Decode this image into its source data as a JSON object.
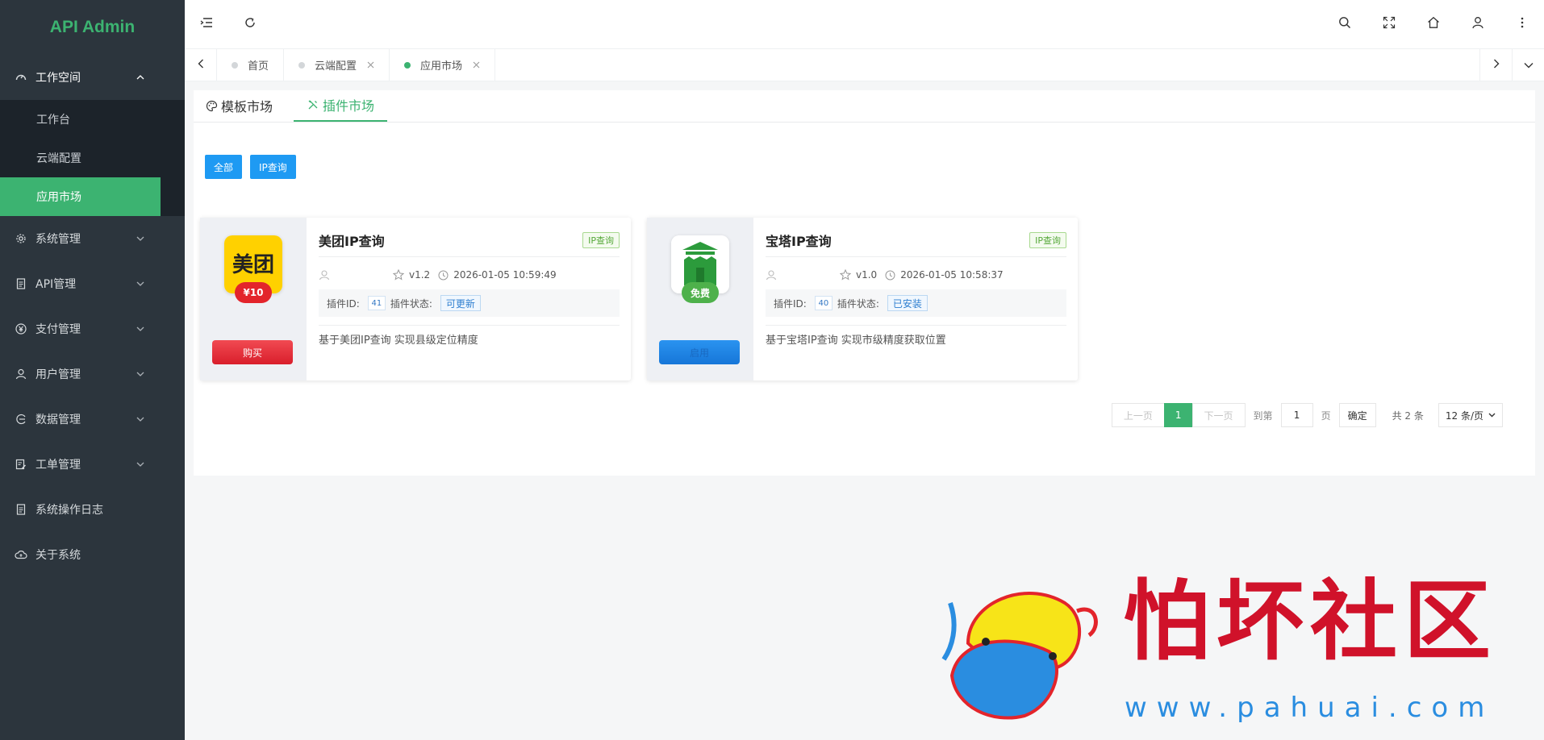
{
  "app": {
    "title": "API Admin",
    "accent": "#3cb371"
  },
  "sidebar": {
    "groups": [
      {
        "label": "工作空间",
        "icon": "dashboard-icon",
        "open": true,
        "children": [
          {
            "label": "工作台"
          },
          {
            "label": "云端配置"
          },
          {
            "label": "应用市场",
            "active": true
          }
        ]
      },
      {
        "label": "系统管理",
        "icon": "gear-icon"
      },
      {
        "label": "API管理",
        "icon": "document-icon"
      },
      {
        "label": "支付管理",
        "icon": "yen-icon"
      },
      {
        "label": "用户管理",
        "icon": "user-icon"
      },
      {
        "label": "数据管理",
        "icon": "data-icon"
      },
      {
        "label": "工单管理",
        "icon": "ticket-icon"
      },
      {
        "label": "系统操作日志",
        "icon": "log-icon"
      },
      {
        "label": "关于系统",
        "icon": "cloud-icon"
      }
    ]
  },
  "tabs": [
    {
      "label": "首页"
    },
    {
      "label": "云端配置"
    },
    {
      "label": "应用市场",
      "active": true
    }
  ],
  "sub_tabs": [
    {
      "label": "模板市场"
    },
    {
      "label": "插件市场",
      "active": true
    }
  ],
  "filters": [
    "全部",
    "IP查询"
  ],
  "cards": [
    {
      "title": "美团IP查询",
      "tag": "IP查询",
      "version": "v1.2",
      "time": "2026-01-05 10:59:49",
      "id_label": "插件ID:",
      "id": "41",
      "status_label": "插件状态:",
      "status": "可更新",
      "desc": "基于美团IP查询 实现县级定位精度",
      "price": "¥10",
      "button": "购买",
      "logo_text": "美团",
      "logo_color": "#ffd100"
    },
    {
      "title": "宝塔IP查询",
      "tag": "IP查询",
      "version": "v1.0",
      "time": "2026-01-05 10:58:37",
      "id_label": "插件ID:",
      "id": "40",
      "status_label": "插件状态:",
      "status": "已安装",
      "desc": "基于宝塔IP查询 实现市级精度获取位置",
      "price": "免费",
      "button": "启用",
      "logo_color": "#2c9b3c"
    }
  ],
  "pager": {
    "prev": "上一页",
    "current": "1",
    "next": "下一页",
    "goto": "到第",
    "page_value": "1",
    "page_unit": "页",
    "confirm": "确定",
    "total": "共 2 条",
    "size": "12 条/页"
  },
  "watermark": {
    "text": "怕坏社区",
    "url": "www.pahuai.com"
  }
}
